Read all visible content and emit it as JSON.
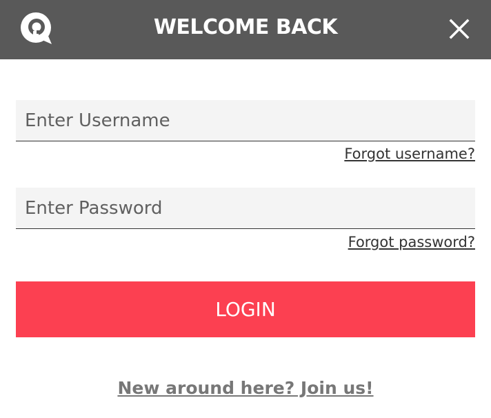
{
  "header": {
    "title": "WELCOME BACK",
    "logo_icon": "chat-bubble-q-logo-icon",
    "close_icon": "close-icon",
    "background": "#595959"
  },
  "form": {
    "username": {
      "placeholder": "Enter Username",
      "value": ""
    },
    "forgot_username": "Forgot username?",
    "password": {
      "placeholder": "Enter Password",
      "value": ""
    },
    "forgot_password": "Forgot password?",
    "login_label": "LOGIN",
    "login_color": "#fc4051"
  },
  "footer": {
    "join_text": "New around here? Join us!"
  }
}
